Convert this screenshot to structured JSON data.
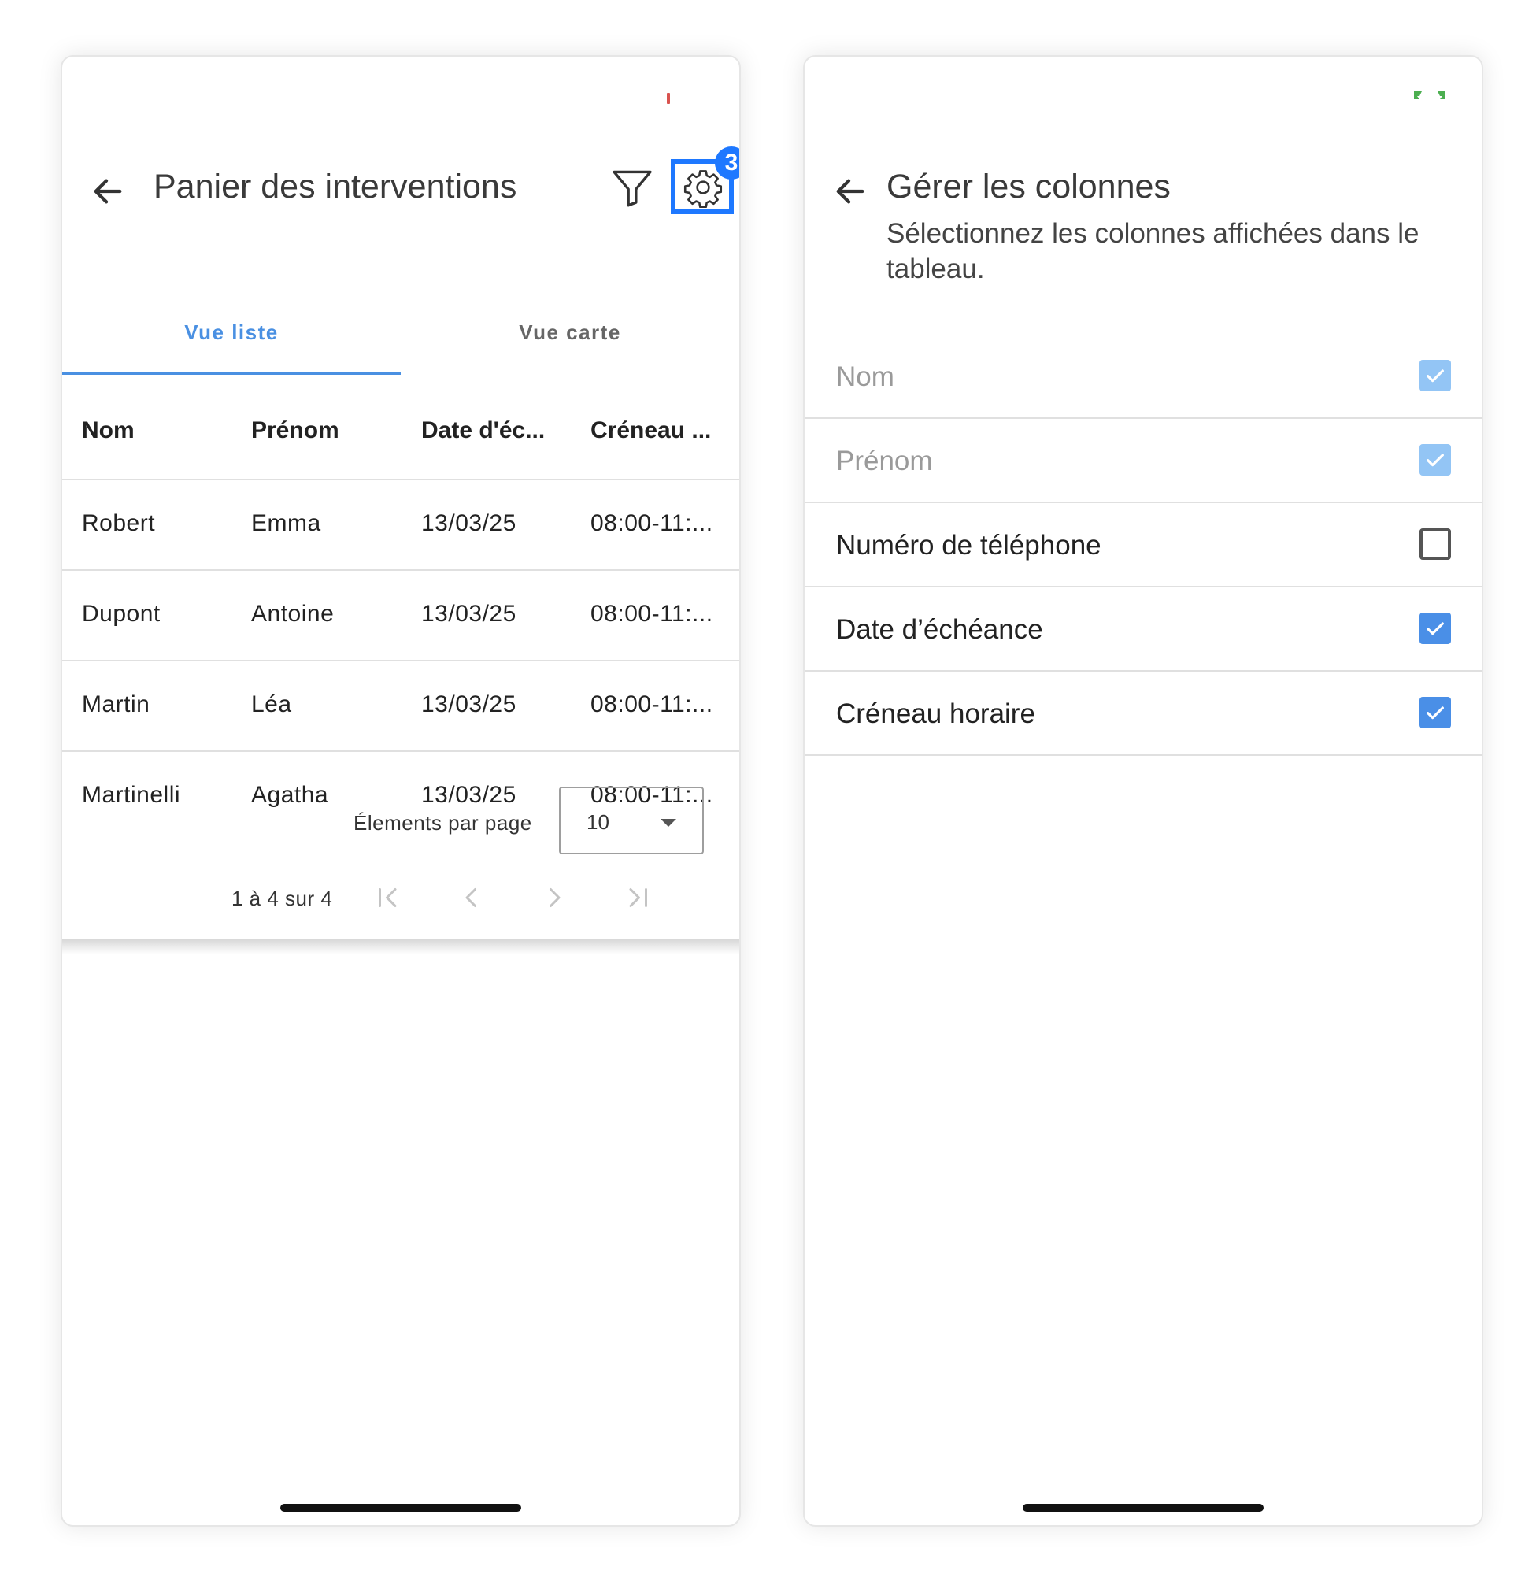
{
  "left_screen": {
    "header": {
      "title": "Panier des interventions",
      "settings_badge": "3"
    },
    "tabs": [
      {
        "label": "Vue liste"
      },
      {
        "label": "Vue carte"
      }
    ],
    "table": {
      "columns": [
        "Nom",
        "Prénom",
        "Date d'éc...",
        "Créneau ..."
      ],
      "rows": [
        [
          "Robert",
          "Emma",
          "13/03/25",
          "08:00-11:..."
        ],
        [
          "Dupont",
          "Antoine",
          "13/03/25",
          "08:00-11:..."
        ],
        [
          "Martin",
          "Léa",
          "13/03/25",
          "08:00-11:..."
        ],
        [
          "Martinelli",
          "Agatha",
          "13/03/25",
          "08:00-11:..."
        ]
      ]
    },
    "pagination": {
      "per_page_label": "Élements par page",
      "per_page_value": "10",
      "range_text": "1 à 4 sur 4"
    }
  },
  "right_screen": {
    "header": {
      "title": "Gérer les colonnes",
      "subtitle": "Sélectionnez les colonnes affichées dans le tableau."
    },
    "columns": [
      {
        "label": "Nom",
        "checked": true,
        "disabled": true
      },
      {
        "label": "Prénom",
        "checked": true,
        "disabled": true
      },
      {
        "label": "Numéro de téléphone",
        "checked": false,
        "disabled": false
      },
      {
        "label": "Date d’échéance",
        "checked": true,
        "disabled": false
      },
      {
        "label": "Créneau horaire",
        "checked": true,
        "disabled": false
      }
    ]
  },
  "colors": {
    "accent": "#4a90e2",
    "highlight": "#1e78ff",
    "checkbox": "#4a8fe7",
    "checkbox_disabled": "#93c5f5"
  }
}
